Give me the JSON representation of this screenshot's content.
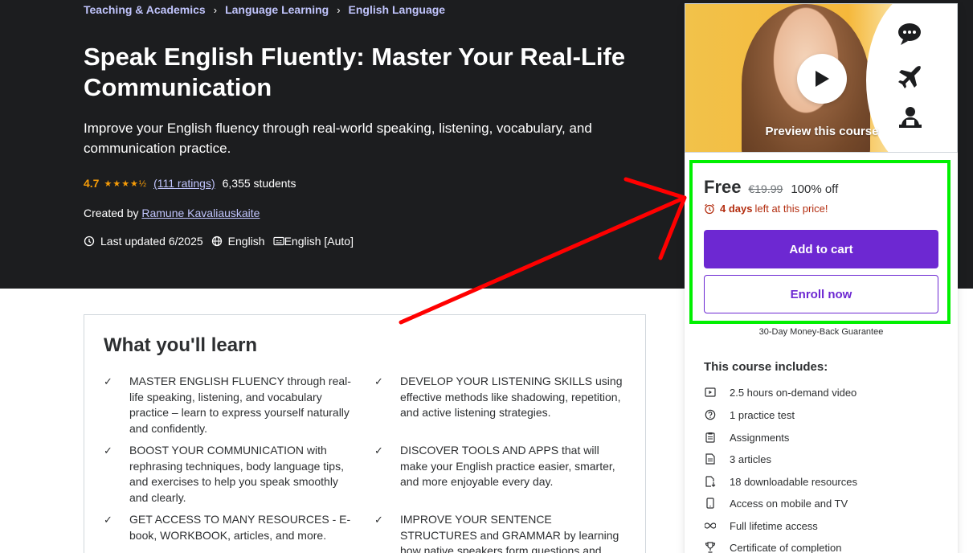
{
  "breadcrumb": [
    "Teaching & Academics",
    "Language Learning",
    "English Language"
  ],
  "course": {
    "title": "Speak English Fluently: Master Your Real-Life Communication",
    "subtitle": "Improve your English fluency through real-world speaking, listening, vocabulary, and communication practice.",
    "rating": "4.7",
    "stars": "★★★★½",
    "ratings_count": "(111 ratings)",
    "students": "6,355 students",
    "created_by_label": "Created by",
    "author": "Ramune Kavaliauskaite",
    "last_updated": "Last updated 6/2025",
    "language": "English",
    "captions": "English [Auto]"
  },
  "learn": {
    "title": "What you'll learn",
    "items": [
      "MASTER ENGLISH FLUENCY through real-life speaking, listening, and vocabulary practice – learn to express yourself naturally and confidently.",
      "DEVELOP YOUR LISTENING SKILLS using effective methods like shadowing, repetition, and active listening strategies.",
      "BOOST YOUR COMMUNICATION with rephrasing techniques, body language tips, and exercises to help you speak smoothly and clearly.",
      "DISCOVER TOOLS AND APPS that will make your English practice easier, smarter, and more enjoyable every day.",
      "GET ACCESS TO MANY RESOURCES - E-book, WORKBOOK, articles, and more.",
      "IMPROVE YOUR SENTENCE STRUCTURES and GRAMMAR by learning how native speakers form questions and answers in real"
    ]
  },
  "sidebar": {
    "preview_label": "Preview this course",
    "price_now": "Free",
    "price_old": "€19.99",
    "discount": "100% off",
    "timer_bold": "4 days",
    "timer_rest": "left at this price!",
    "add_to_cart": "Add to cart",
    "enroll_now": "Enroll now",
    "guarantee": "30-Day Money-Back Guarantee",
    "includes_title": "This course includes:",
    "includes": [
      {
        "icon": "video-icon",
        "label": "2.5 hours on-demand video"
      },
      {
        "icon": "question-icon",
        "label": "1 practice test"
      },
      {
        "icon": "clipboard-icon",
        "label": "Assignments"
      },
      {
        "icon": "article-icon",
        "label": "3 articles"
      },
      {
        "icon": "download-file-icon",
        "label": "18 downloadable resources"
      },
      {
        "icon": "mobile-icon",
        "label": "Access on mobile and TV"
      },
      {
        "icon": "infinity-icon",
        "label": "Full lifetime access"
      },
      {
        "icon": "trophy-icon",
        "label": "Certificate of completion"
      }
    ]
  },
  "colors": {
    "hero_bg": "#1c1d1f",
    "accent_purple": "#6d28d2",
    "link_lavender": "#c0c4fc",
    "rating_orange": "#f69c08",
    "timer_red": "#b32d0f",
    "annotation_green": "#00f000",
    "annotation_red": "#ff0000"
  }
}
